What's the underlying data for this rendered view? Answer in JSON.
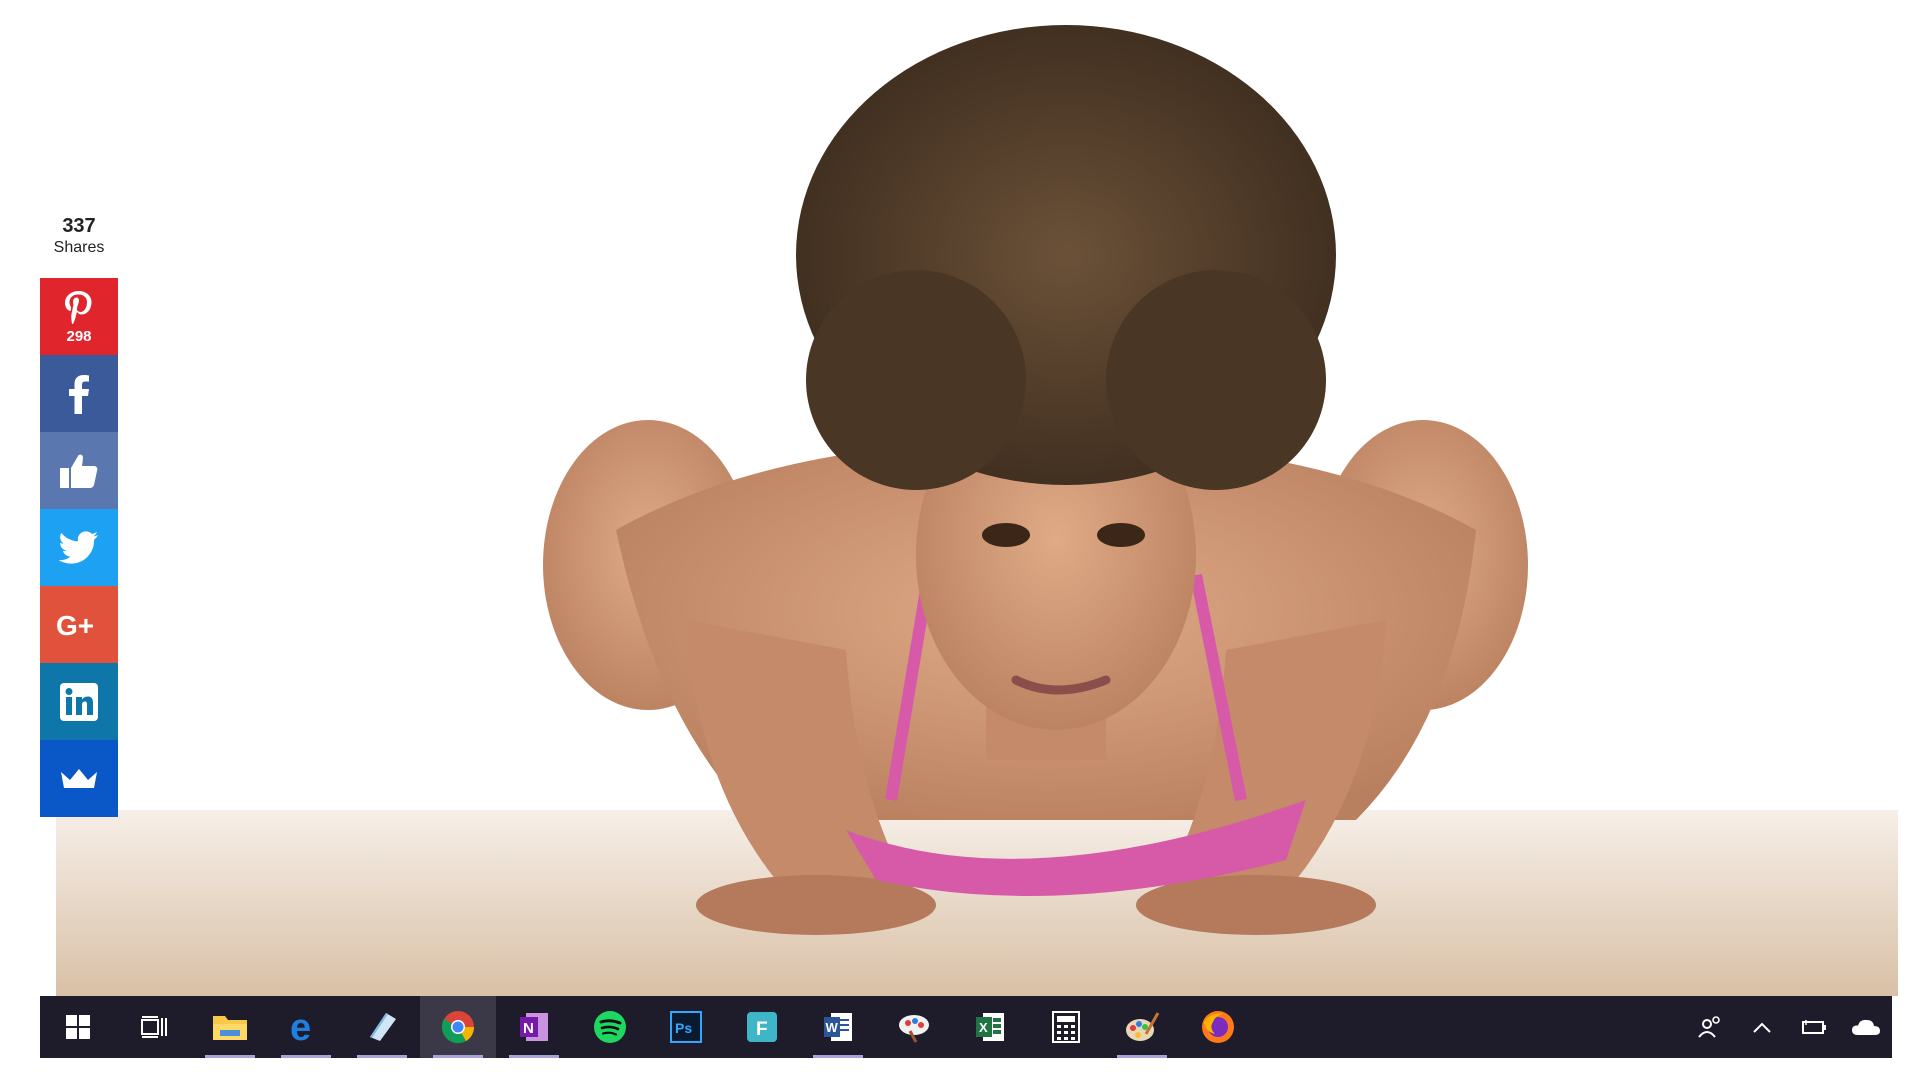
{
  "share": {
    "total": "337",
    "label": "Shares",
    "buttons": [
      {
        "id": "pinterest",
        "icon": "pinterest-icon",
        "color": "#e0252d",
        "count": "298"
      },
      {
        "id": "facebook",
        "icon": "facebook-icon",
        "color": "#3b5a9a",
        "count": ""
      },
      {
        "id": "like",
        "icon": "thumbs-up-icon",
        "color": "#5a77b0",
        "count": ""
      },
      {
        "id": "twitter",
        "icon": "twitter-bird-icon",
        "color": "#1da1f2",
        "count": ""
      },
      {
        "id": "googleplus",
        "icon": "google-plus-icon",
        "color": "#e0523b",
        "count": ""
      },
      {
        "id": "linkedin",
        "icon": "linkedin-icon",
        "color": "#0e76a8",
        "count": ""
      },
      {
        "id": "sumome",
        "icon": "crown-icon",
        "color": "#0a57c8",
        "count": ""
      }
    ]
  },
  "taskbar": {
    "background": "#1e1c2b",
    "apps": [
      {
        "name": "start",
        "icon": "windows-start-icon",
        "active": false,
        "open": false
      },
      {
        "name": "task-view",
        "icon": "task-view-icon",
        "active": false,
        "open": false
      },
      {
        "name": "file-explorer",
        "icon": "folder-icon",
        "active": false,
        "open": true
      },
      {
        "name": "edge",
        "icon": "edge-browser-icon",
        "active": false,
        "open": true
      },
      {
        "name": "notes",
        "icon": "note-pad-icon",
        "active": false,
        "open": true
      },
      {
        "name": "chrome",
        "icon": "chrome-icon",
        "active": true,
        "open": true
      },
      {
        "name": "onenote",
        "icon": "onenote-icon",
        "active": false,
        "open": true
      },
      {
        "name": "spotify",
        "icon": "spotify-icon",
        "active": false,
        "open": false
      },
      {
        "name": "photoshop",
        "icon": "photoshop-icon",
        "active": false,
        "open": false
      },
      {
        "name": "f-app",
        "icon": "f-app-icon",
        "active": false,
        "open": false
      },
      {
        "name": "word",
        "icon": "word-icon",
        "active": false,
        "open": true
      },
      {
        "name": "paint-splash",
        "icon": "paint-splash-icon",
        "active": false,
        "open": false
      },
      {
        "name": "excel",
        "icon": "excel-icon",
        "active": false,
        "open": false
      },
      {
        "name": "calculator",
        "icon": "calculator-icon",
        "active": false,
        "open": false
      },
      {
        "name": "paint",
        "icon": "paint-palette-icon",
        "active": false,
        "open": true
      },
      {
        "name": "firefox",
        "icon": "firefox-icon",
        "active": false,
        "open": false
      }
    ],
    "tray": [
      {
        "name": "people",
        "icon": "people-icon"
      },
      {
        "name": "show-hidden",
        "icon": "chevron-up-icon"
      },
      {
        "name": "battery",
        "icon": "battery-icon"
      },
      {
        "name": "onedrive",
        "icon": "cloud-icon"
      }
    ]
  }
}
